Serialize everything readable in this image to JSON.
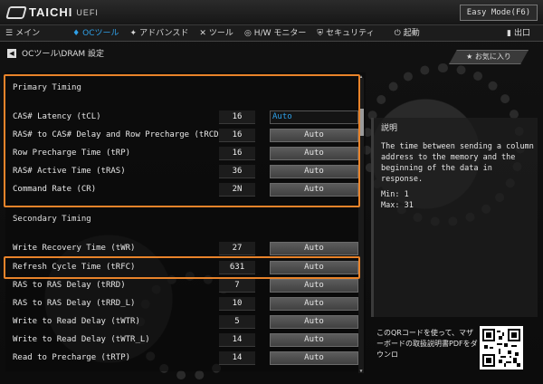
{
  "header": {
    "logo_text": "TAICHI",
    "logo_sub": "UEFI",
    "easy_mode": "Easy Mode(F6)"
  },
  "tabs": [
    {
      "label": "メイン",
      "icon": "list-icon"
    },
    {
      "label": "OCツール",
      "icon": "droplet-icon",
      "active": true
    },
    {
      "label": "アドバンスド",
      "icon": "star-icon"
    },
    {
      "label": "ツール",
      "icon": "wrench-icon"
    },
    {
      "label": "H/W モニター",
      "icon": "monitor-icon"
    },
    {
      "label": "セキュリティ",
      "icon": "shield-icon"
    },
    {
      "label": "起動",
      "icon": "power-icon"
    },
    {
      "label": "出口",
      "icon": "door-icon"
    }
  ],
  "breadcrumb": "OCツール\\DRAM 設定",
  "favorite_label": "お気に入り",
  "primary": {
    "header": "Primary Timing",
    "rows": [
      {
        "label": "CAS# Latency (tCL)",
        "value": "16",
        "setting": "Auto"
      },
      {
        "label": "RAS# to CAS# Delay and Row Precharge (tRCDtRP)",
        "value": "16",
        "setting": "Auto"
      },
      {
        "label": "Row Precharge Time (tRP)",
        "value": "16",
        "setting": "Auto"
      },
      {
        "label": "RAS# Active Time (tRAS)",
        "value": "36",
        "setting": "Auto"
      },
      {
        "label": "Command Rate (CR)",
        "value": "2N",
        "setting": "Auto"
      }
    ]
  },
  "secondary": {
    "header": "Secondary Timing",
    "rows": [
      {
        "label": "Write Recovery Time (tWR)",
        "value": "27",
        "setting": "Auto"
      },
      {
        "label": "Refresh Cycle Time (tRFC)",
        "value": "631",
        "setting": "Auto"
      },
      {
        "label": "RAS to RAS Delay (tRRD)",
        "value": "7",
        "setting": "Auto"
      },
      {
        "label": "RAS to RAS Delay (tRRD_L)",
        "value": "10",
        "setting": "Auto"
      },
      {
        "label": "Write to Read Delay (tWTR)",
        "value": "5",
        "setting": "Auto"
      },
      {
        "label": "Write to Read Delay (tWTR_L)",
        "value": "14",
        "setting": "Auto"
      },
      {
        "label": "Read to Precharge (tRTP)",
        "value": "14",
        "setting": "Auto"
      }
    ]
  },
  "description": {
    "title": "説明",
    "body": "The time between sending a column address to the memory and the beginning of the data in response.",
    "min": "Min: 1",
    "max": "Max: 31"
  },
  "qr_text": "このQRコードを使って、マザーボードの取扱説明書PDFをダウンロ",
  "colors": {
    "accent": "#2fa0e8",
    "highlight": "#e8832a"
  }
}
